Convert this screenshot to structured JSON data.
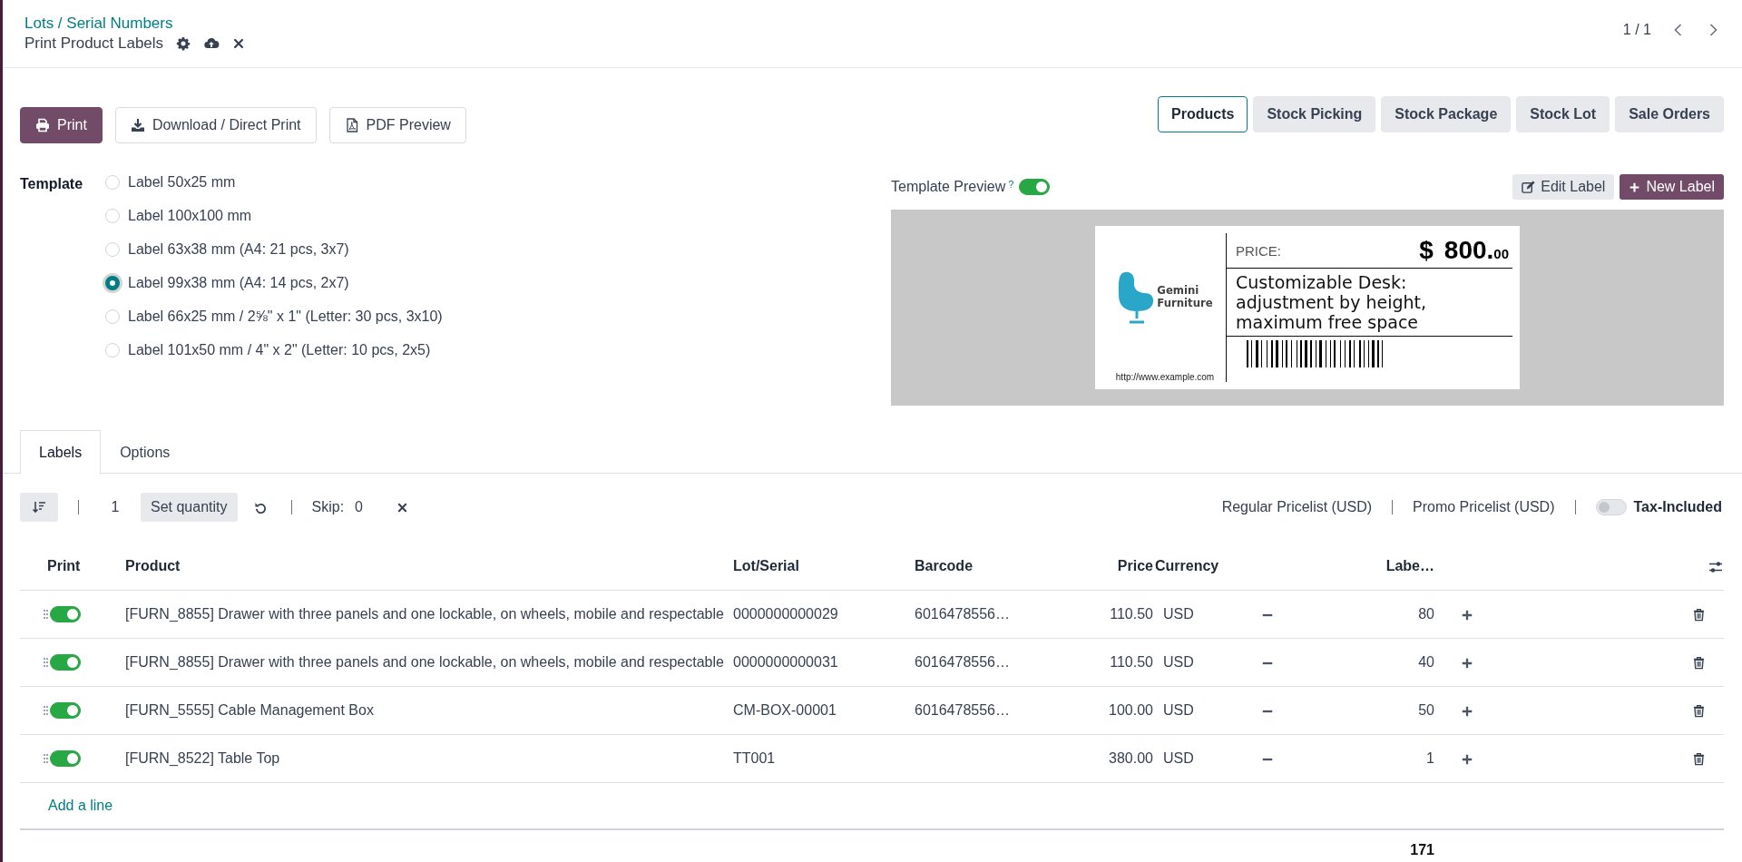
{
  "breadcrumb": {
    "parent": "Lots / Serial Numbers",
    "current": "Print Product Labels"
  },
  "pager": "1 / 1",
  "actions": [
    {
      "label": "Print",
      "kind": "print"
    },
    {
      "label": "Download / Direct Print",
      "kind": "download"
    },
    {
      "label": "PDF Preview",
      "kind": "pdf"
    }
  ],
  "sources": [
    {
      "label": "Products",
      "selected": true
    },
    {
      "label": "Stock Picking",
      "selected": false
    },
    {
      "label": "Stock Package",
      "selected": false
    },
    {
      "label": "Stock Lot",
      "selected": false
    },
    {
      "label": "Sale Orders",
      "selected": false
    }
  ],
  "template": {
    "label": "Template",
    "options": [
      {
        "label": "Label 50x25 mm",
        "selected": false
      },
      {
        "label": "Label 100x100 mm",
        "selected": false
      },
      {
        "label": "Label 63x38 mm (A4: 21 pcs, 3x7)",
        "selected": false
      },
      {
        "label": "Label 99x38 mm (A4: 14 pcs, 2x7)",
        "selected": true
      },
      {
        "label": "Label 66x25 mm / 2⅝\" x 1\" (Letter: 30 pcs, 3x10)",
        "selected": false
      },
      {
        "label": "Label 101x50 mm / 4\" x 2\" (Letter: 10 pcs, 2x5)",
        "selected": false
      }
    ]
  },
  "template_preview": {
    "label": "Template Preview",
    "help": "?",
    "on": true
  },
  "label_buttons": [
    {
      "label": "Edit Label",
      "kind": "edit"
    },
    {
      "label": "New Label",
      "kind": "new"
    }
  ],
  "label_preview": {
    "logo_lines": [
      "Gemini",
      "Furniture"
    ],
    "url": "http://www.example.com",
    "price_caption": "PRICE:",
    "currency": "$",
    "price": "800.",
    "cents": "00",
    "description_lines": [
      "Customizable Desk:",
      "adjustment by height,",
      "maximum free space"
    ]
  },
  "tabs": [
    {
      "label": "Labels",
      "selected": true
    },
    {
      "label": "Options",
      "selected": false
    }
  ],
  "toolbar": {
    "quantity": "1",
    "set_quantity": "Set quantity",
    "skip_label": "Skip:",
    "skip": "0",
    "pricelists": [
      "Regular Pricelist (USD)",
      "Promo Pricelist (USD)"
    ],
    "tax_included": {
      "label": "Tax-Included",
      "on": false
    }
  },
  "table": {
    "columns": [
      "Print",
      "Product",
      "Lot/Serial",
      "Barcode",
      "Price",
      "Currency",
      "Labe…"
    ],
    "rows": [
      {
        "print": true,
        "product": "[FURN_8855] Drawer with three panels and one lockable, on wheels, mobile and respectable",
        "lot": "0000000000029",
        "barcode": "6016478556…",
        "price": "110.50",
        "currency": "USD",
        "labels": "80"
      },
      {
        "print": true,
        "product": "[FURN_8855] Drawer with three panels and one lockable, on wheels, mobile and respectable",
        "lot": "0000000000031",
        "barcode": "6016478556…",
        "price": "110.50",
        "currency": "USD",
        "labels": "40"
      },
      {
        "print": true,
        "product": "[FURN_5555] Cable Management Box",
        "lot": "CM-BOX-00001",
        "barcode": "6016478556…",
        "price": "100.00",
        "currency": "USD",
        "labels": "50"
      },
      {
        "print": true,
        "product": "[FURN_8522] Table Top",
        "lot": "TT001",
        "price": "380.00",
        "currency": "USD",
        "labels": "1"
      }
    ],
    "add_line": "Add a line",
    "total": "171"
  }
}
